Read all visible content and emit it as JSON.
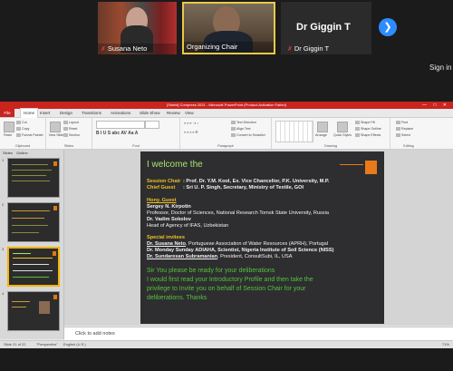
{
  "meeting": {
    "participants": [
      {
        "name": "Susana Neto",
        "muted": true
      },
      {
        "name": "Organizing Chair",
        "muted": false
      },
      {
        "name": "Dr Giggin T",
        "muted": true
      }
    ],
    "featured_name": "Dr Giggin T",
    "sign_in": "Sign in",
    "next_icon": "chevron-right-icon",
    "active_speaker_color": "#e6c94a",
    "accent_color": "#2d8cff"
  },
  "powerpoint": {
    "window_title": "[Shield] Compress 2021 - Microsoft PowerPoint (Product Activation Failed)",
    "file_tab": "File",
    "tabs": [
      "Home",
      "Insert",
      "Design",
      "Transitions",
      "Animations",
      "Slide Show",
      "Review",
      "View"
    ],
    "active_tab": "Home",
    "ribbon": {
      "clipboard": {
        "label": "Clipboard",
        "paste": "Paste",
        "cut": "Cut",
        "copy": "Copy",
        "format_painter": "Format Painter"
      },
      "slides": {
        "label": "Slides",
        "new_slide": "New Slide",
        "layout": "Layout",
        "reset": "Reset",
        "section": "Section"
      },
      "font": {
        "label": "Font"
      },
      "paragraph": {
        "label": "Paragraph",
        "text_direction": "Text Direction",
        "align_text": "Align Text",
        "convert": "Convert to SmartArt"
      },
      "drawing": {
        "label": "Drawing",
        "arrange": "Arrange",
        "quick_styles": "Quick Styles",
        "shape_fill": "Shape Fill",
        "shape_outline": "Shape Outline",
        "shape_effects": "Shape Effects"
      },
      "editing": {
        "label": "Editing",
        "find": "Find",
        "replace": "Replace",
        "select": "Select"
      }
    },
    "pane_tabs": [
      "Slides",
      "Outline"
    ],
    "thumbnails": [
      "1",
      "2",
      "3",
      "4"
    ],
    "selected_thumbnail": 2,
    "notes_placeholder": "Click to add notes",
    "status": {
      "slide": "Slide 21 of 22",
      "theme": "\"Perspective\"",
      "language": "English (U.S.)",
      "zoom": "71%"
    }
  },
  "slide": {
    "welcome": "I welcome the",
    "session_chair_label": "Session Chair",
    "session_chair": ": Prof. Dr. Y.M. Kool, Ex. Vice Chancellor, P.K. University, M.P.",
    "chief_guest_label": "Chief Guest",
    "chief_guest": ": Sri U. P. Singh, Secretary, Ministry of Textile, GOI",
    "hony_guest_label": "Hony. Guest",
    "guest1_name": "Sergey N. Kirpotin",
    "guest1_role": "Professor, Doctor of Sciences, National Research Tomsk State University, Russia",
    "guest2_name": "Dr. Vadim Sokolov",
    "guest2_role": "Head of Agency of IFAS, Uzbekistan",
    "special_label": "Special invitees",
    "invitee1_name": "Dr. Susana Neto",
    "invitee1_rest": ", Portuguese Association of Water Resources (APRH), Portugal",
    "invitee2": "Dr. Monday Sunday ADIAHA, Scientist, Nigeria Institute of Soil Science (NISS)",
    "invitee3_name": "Dr. Sundaresan Subramanian",
    "invitee3_rest": ", President, ConsultSubi, IL, USA",
    "closing1": "Sir You please be ready for your deliberations",
    "closing2": "I would first read your Introductory Profile and then take the",
    "closing3": "privilege to Invite you on behalf of Session Chair for your",
    "closing4": "deliberations. Thanks"
  }
}
